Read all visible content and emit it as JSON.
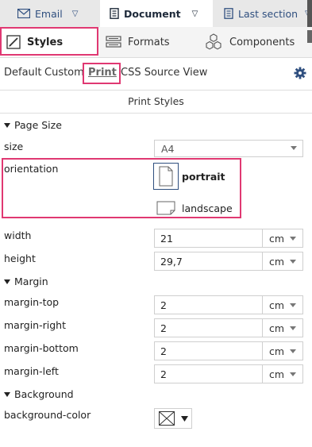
{
  "top_tabs": [
    {
      "label": "Email",
      "active": false
    },
    {
      "label": "Document",
      "active": true
    },
    {
      "label": "Last section",
      "active": false
    }
  ],
  "panel_tabs": [
    {
      "label": "Styles",
      "active": true
    },
    {
      "label": "Formats",
      "active": false
    },
    {
      "label": "Components",
      "active": false
    }
  ],
  "sub_tabs": [
    {
      "label": "Default",
      "active": false
    },
    {
      "label": "Custom",
      "active": false
    },
    {
      "label": "Print",
      "active": true
    },
    {
      "label": "CSS Source View",
      "active": false
    }
  ],
  "section_title": "Print Styles",
  "page_size": {
    "group_label": "Page Size",
    "size_label": "size",
    "size_value": "A4",
    "orientation_label": "orientation",
    "orientation_options": [
      {
        "label": "portrait",
        "selected": true
      },
      {
        "label": "landscape",
        "selected": false
      }
    ],
    "width_label": "width",
    "width_value": "21",
    "width_unit": "cm",
    "height_label": "height",
    "height_value": "29,7",
    "height_unit": "cm"
  },
  "margin": {
    "group_label": "Margin",
    "fields": [
      {
        "label": "margin-top",
        "value": "2",
        "unit": "cm"
      },
      {
        "label": "margin-right",
        "value": "2",
        "unit": "cm"
      },
      {
        "label": "margin-bottom",
        "value": "2",
        "unit": "cm"
      },
      {
        "label": "margin-left",
        "value": "2",
        "unit": "cm"
      }
    ]
  },
  "background": {
    "group_label": "Background",
    "color_label": "background-color"
  },
  "colors": {
    "highlight": "#e03872",
    "tab_text": "#2f4f7f",
    "gear": "#2f4f7f"
  }
}
